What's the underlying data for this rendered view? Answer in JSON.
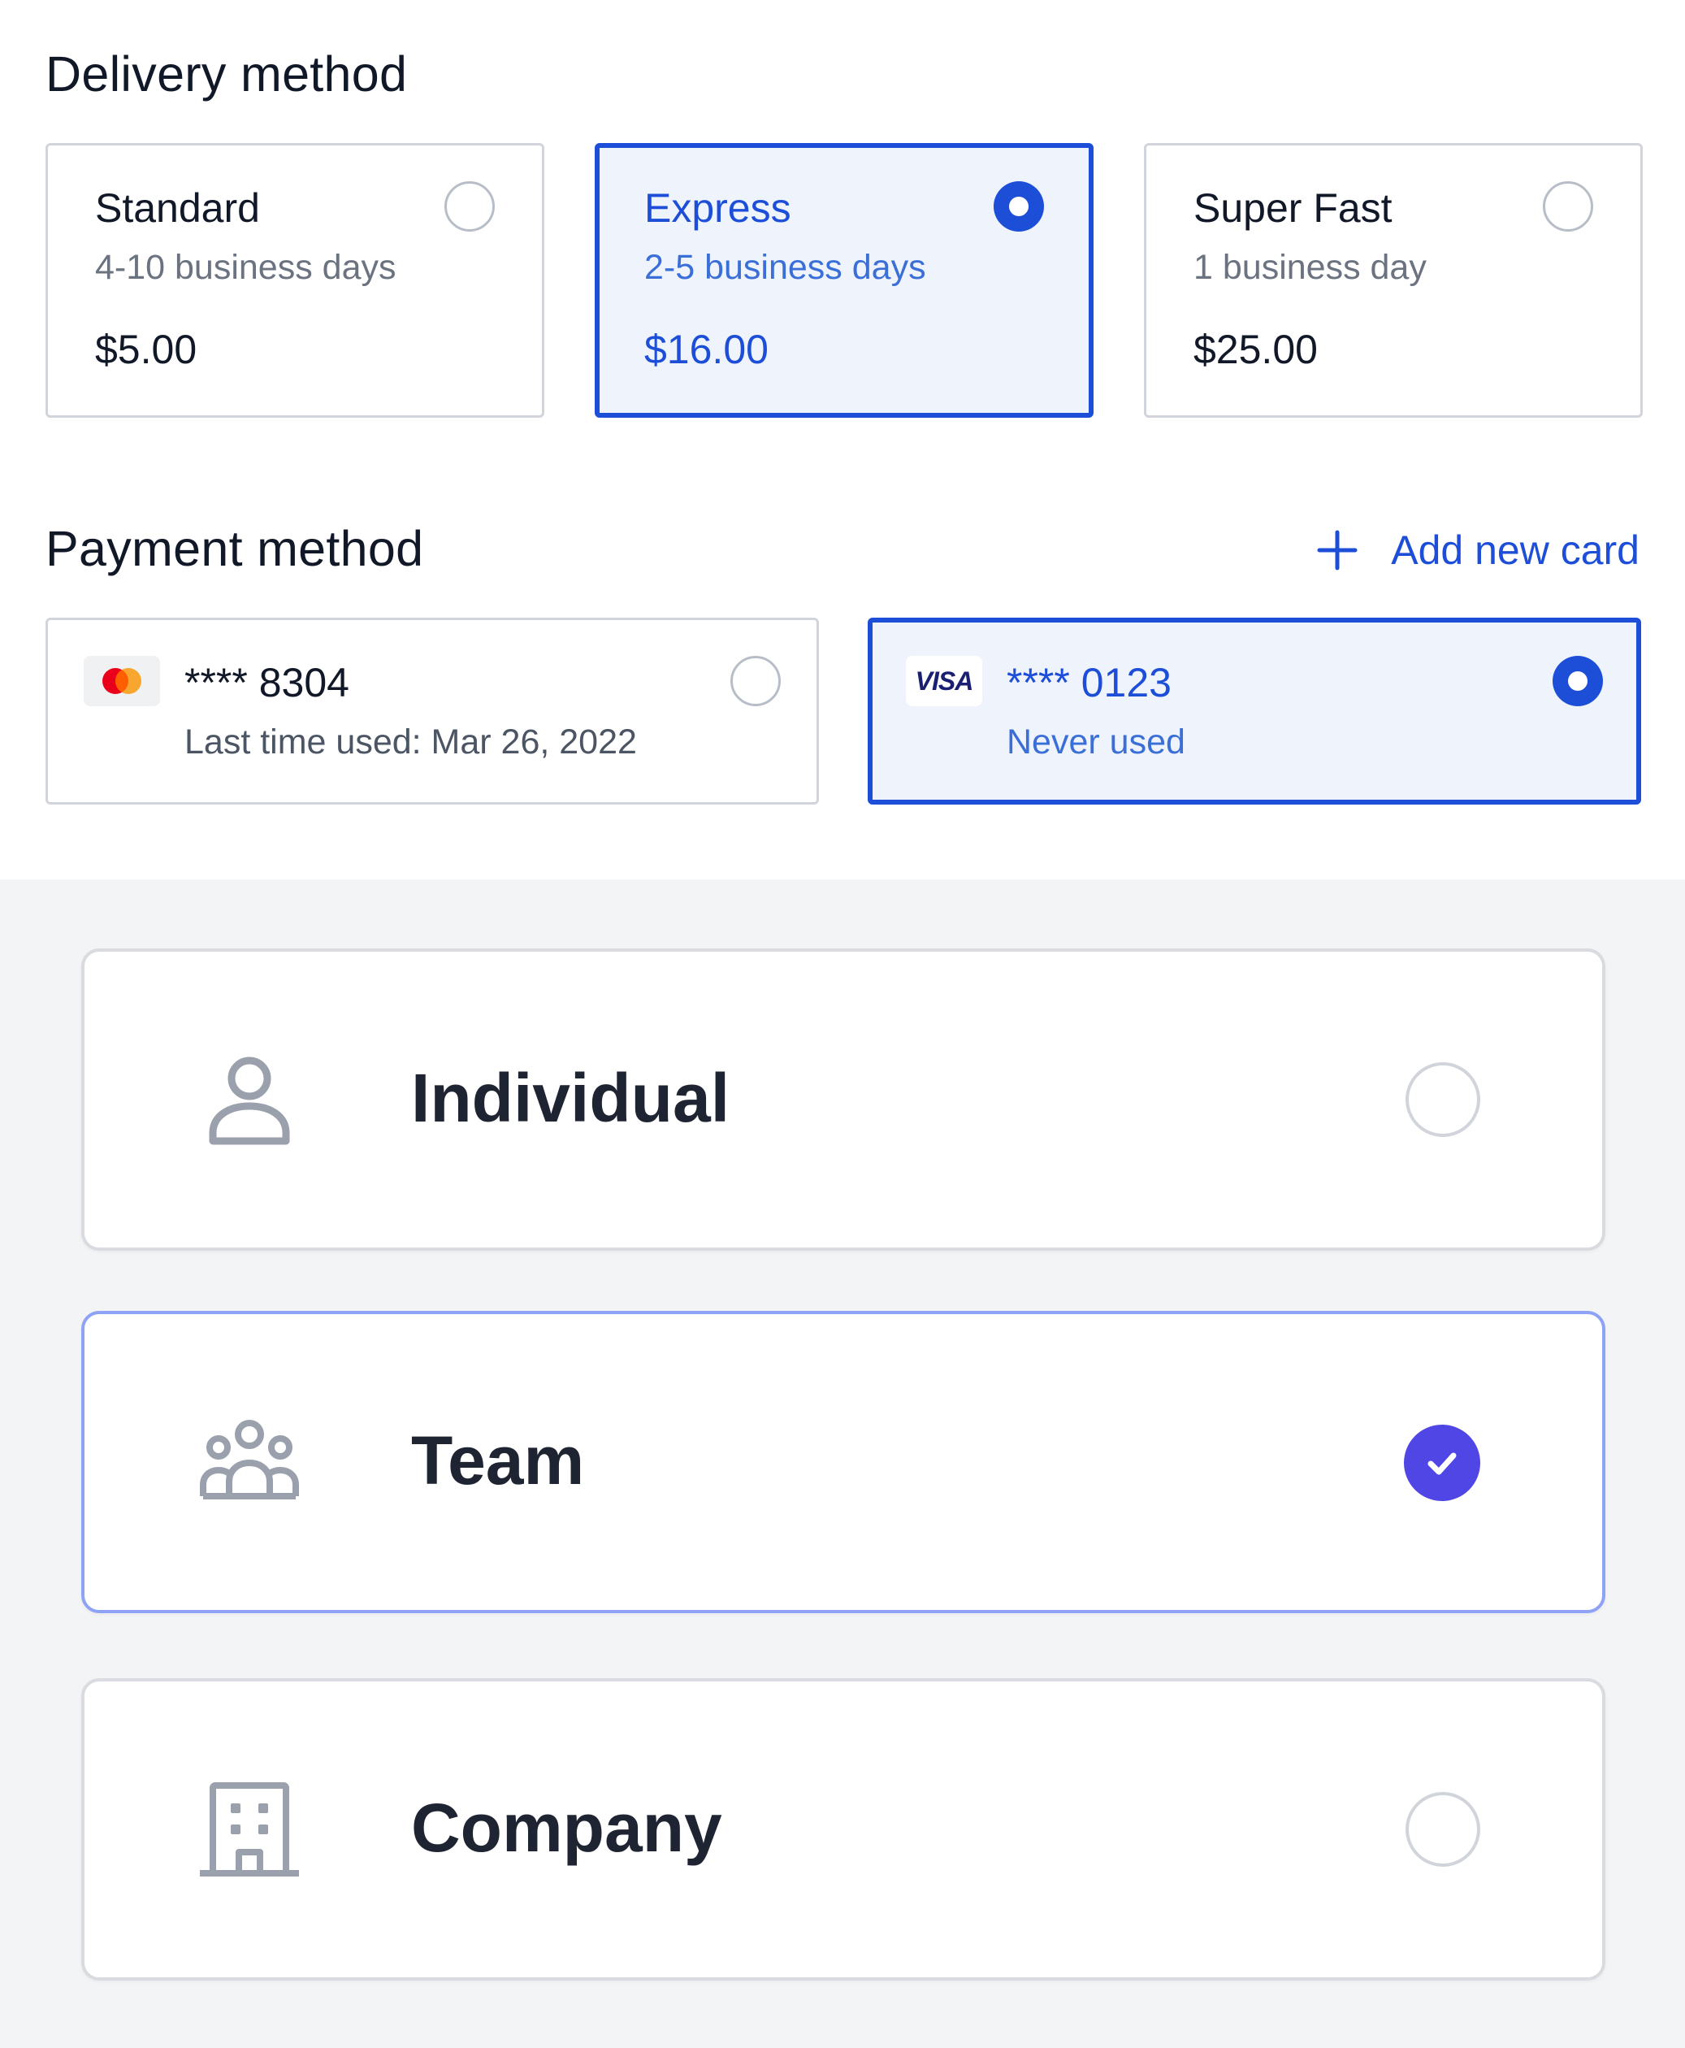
{
  "delivery": {
    "title": "Delivery method",
    "options": [
      {
        "name": "Standard",
        "days": "4-10 business days",
        "price": "$5.00",
        "selected": false
      },
      {
        "name": "Express",
        "days": "2-5 business days",
        "price": "$16.00",
        "selected": true
      },
      {
        "name": "Super Fast",
        "days": "1 business day",
        "price": "$25.00",
        "selected": false
      }
    ]
  },
  "payment": {
    "title": "Payment method",
    "add_card_label": "Add new card",
    "cards": [
      {
        "brand_icon": "mastercard-icon",
        "number": "**** 8304",
        "sub": "Last time used: Mar 26, 2022",
        "selected": false
      },
      {
        "brand_icon": "visa-icon",
        "brand_text": "VISA",
        "number": "**** 0123",
        "sub": "Never used",
        "selected": true
      }
    ]
  },
  "account_types": [
    {
      "label": "Individual",
      "icon": "user-icon",
      "selected": false
    },
    {
      "label": "Team",
      "icon": "users-group-icon",
      "selected": true
    },
    {
      "label": "Company",
      "icon": "building-icon",
      "selected": false
    }
  ],
  "colors": {
    "accent_blue": "#1d4ed8",
    "selected_card_bg": "#eef3fc",
    "account_accent": "#4f46e5",
    "account_selected_border": "#8ea3f5",
    "panel_bg": "#f3f4f6"
  }
}
